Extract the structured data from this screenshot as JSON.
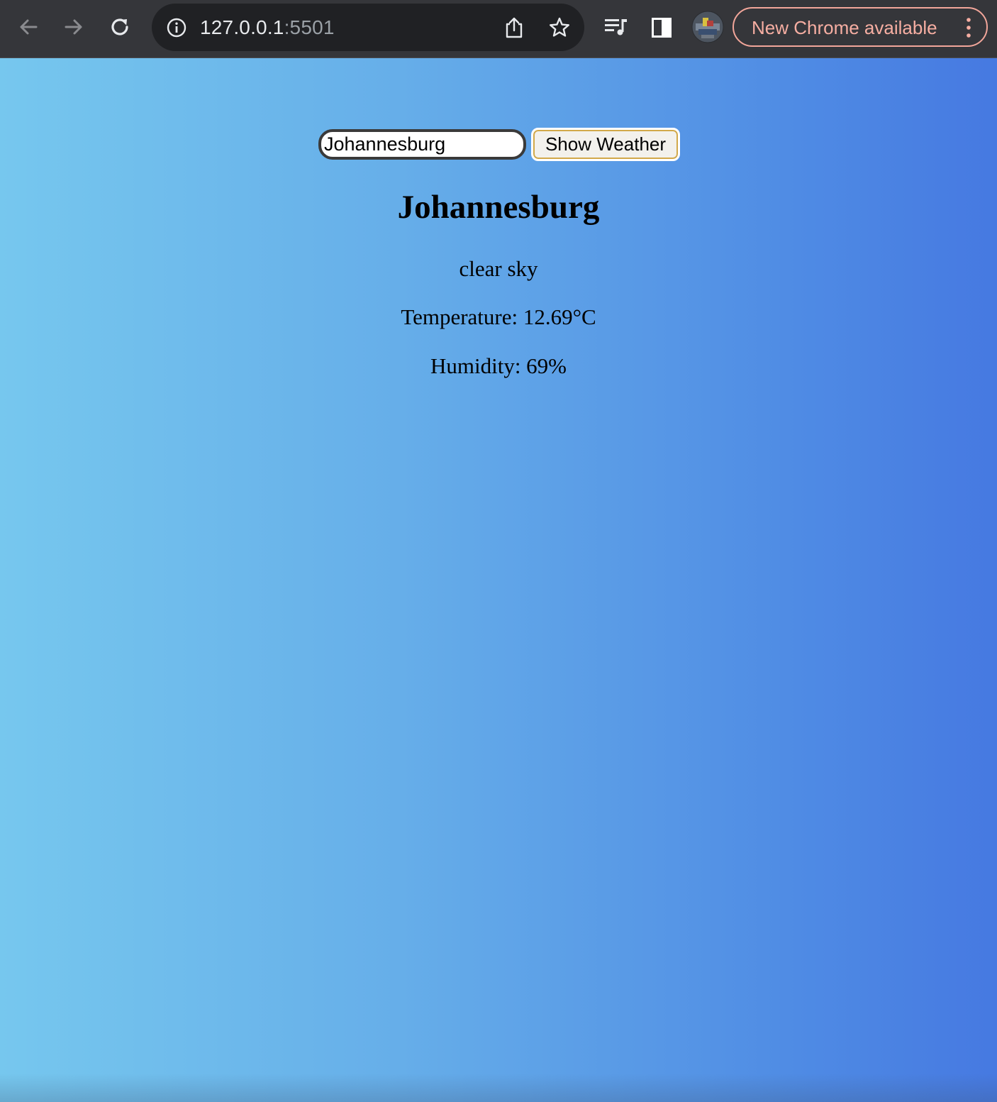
{
  "browser": {
    "url_host": "127.0.0.1",
    "url_port": ":5501",
    "update_label": "New Chrome available"
  },
  "weather_form": {
    "input_value": "Johannesburg",
    "button_label": "Show Weather"
  },
  "weather_result": {
    "city": "Johannesburg",
    "description": "clear sky",
    "temperature": "Temperature: 12.69°C",
    "humidity": "Humidity: 69%"
  }
}
